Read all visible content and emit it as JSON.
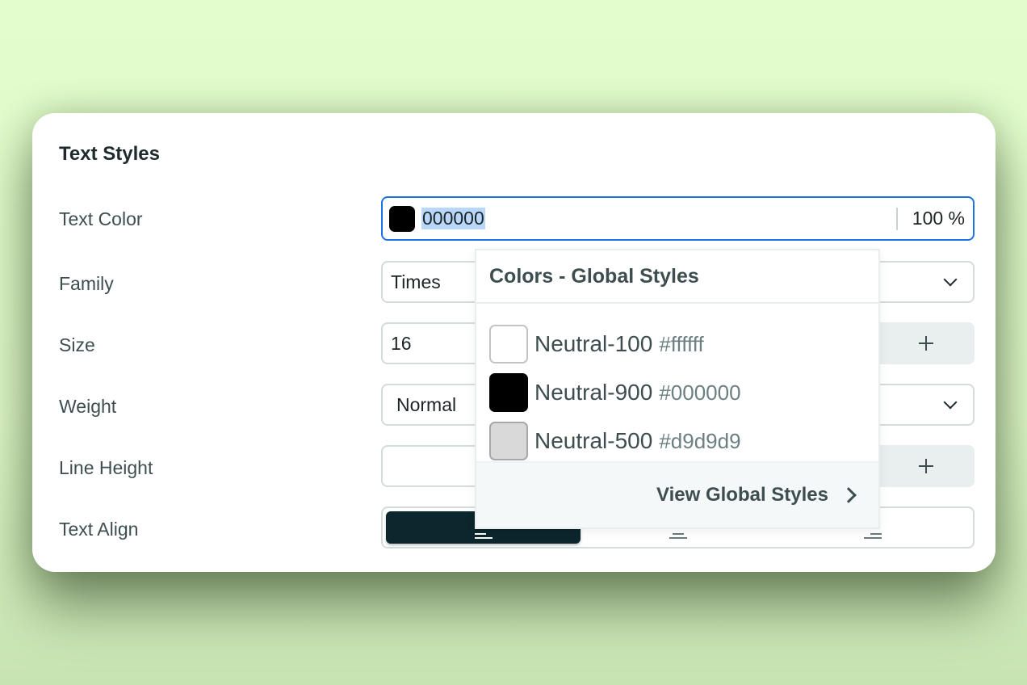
{
  "panel": {
    "title": "Text Styles",
    "rows": {
      "text_color": {
        "label": "Text Color",
        "swatch_color": "#000000",
        "hex_value": "000000",
        "opacity_value": "100",
        "opacity_unit": "%"
      },
      "family": {
        "label": "Family",
        "value": "Times"
      },
      "size": {
        "label": "Size",
        "value": "16"
      },
      "weight": {
        "label": "Weight",
        "value": "Normal"
      },
      "line_height": {
        "label": "Line Height",
        "value": ""
      },
      "text_align": {
        "label": "Text Align",
        "options": [
          "left",
          "center",
          "right"
        ],
        "selected": "left"
      }
    }
  },
  "color_dropdown": {
    "title": "Colors - Global Styles",
    "items": [
      {
        "name": "Neutral-100",
        "hex": "#ffffff"
      },
      {
        "name": "Neutral-900",
        "hex": "#000000"
      },
      {
        "name": "Neutral-500",
        "hex": "#d9d9d9"
      }
    ],
    "footer_link": "View Global Styles"
  },
  "colors": {
    "focus_border": "#1a73e8",
    "selection_highlight": "#b8d7fb",
    "active_align": "#0b262d",
    "background": "#e3fdcd"
  }
}
